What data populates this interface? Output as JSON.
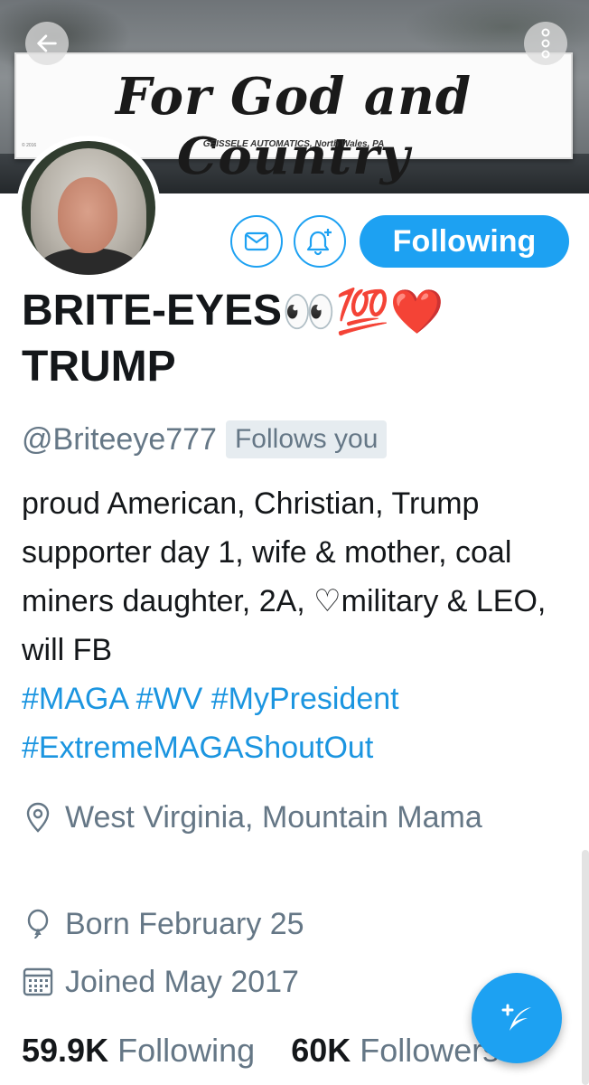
{
  "banner": {
    "motto": "For God and Country",
    "maker": "GEISSELE AUTOMATICS, North Wales, PA"
  },
  "header": {
    "back_icon": "back-arrow-icon",
    "more_icon": "more-vertical-icon"
  },
  "actions": {
    "message_icon": "envelope-icon",
    "notify_icon": "bell-plus-icon",
    "follow_label": "Following"
  },
  "profile": {
    "name_line1": "BRITE-EYES",
    "name_emojis": "👀💯❤️",
    "name_line2": "TRUMP",
    "handle": "@Briteeye777",
    "follows_you": "Follows you",
    "bio_text": "proud American, Christian, Trump supporter day 1, wife & mother, coal miners daughter, 2A, ♡military & LEO, will FB",
    "bio_tags_line1": "#MAGA #WV #MyPresident",
    "bio_tags_line2": "#ExtremeMAGAShoutOut",
    "location": "West Virginia,  Mountain Mama",
    "birthday": "Born February 25",
    "joined": "Joined May 2017"
  },
  "stats": {
    "following_count": "59.9K",
    "following_label": "Following",
    "followers_count": "60K",
    "followers_label": "Followers"
  },
  "colors": {
    "accent": "#1da1f2",
    "secondary_text": "#657786",
    "primary_text": "#14171a"
  },
  "fab": {
    "icon": "compose-feather-icon"
  }
}
